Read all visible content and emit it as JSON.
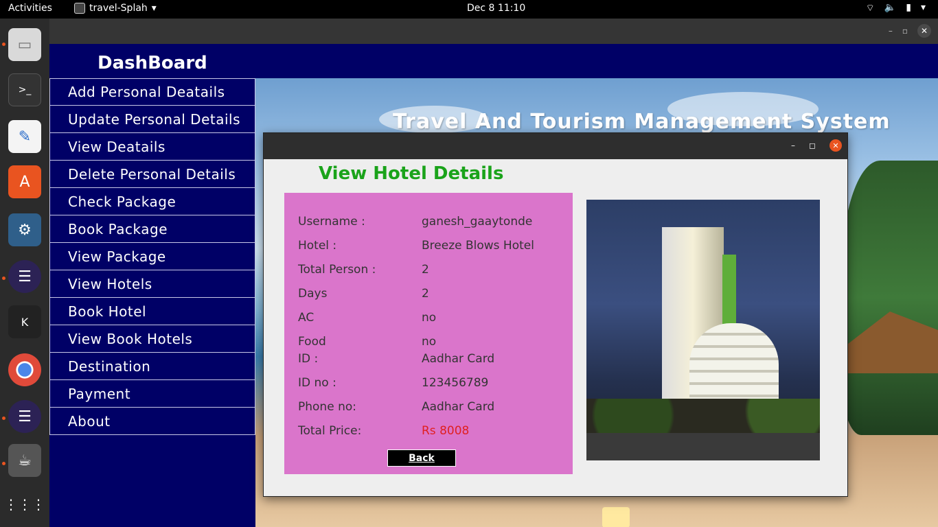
{
  "topbar": {
    "activities": "Activities",
    "app_name": "travel-Splah",
    "clock": "Dec 8  11:10"
  },
  "dock": {
    "items": [
      "files-icon",
      "terminal-icon",
      "text-editor-icon",
      "app-store-icon",
      "mysql-workbench-icon",
      "eclipse-icon",
      "kde-connect-icon",
      "chrome-icon",
      "eclipse-icon-2",
      "java-icon",
      "show-apps-icon"
    ]
  },
  "dashboard": {
    "title": "DashBoard",
    "system_name": "Travel And Tourism Management System",
    "menu": [
      "Add Personal Deatails",
      "Update Personal Details",
      "View Deatails",
      "Delete Personal Details",
      "Check Package",
      "Book Package",
      "View Package",
      "View Hotels",
      "Book Hotel",
      "View Book Hotels",
      "Destination",
      "Payment",
      "About"
    ]
  },
  "dialog": {
    "heading": "View Hotel Details",
    "rows": [
      {
        "label": "Username :",
        "value": "ganesh_gaaytonde"
      },
      {
        "label": "Hotel :",
        "value": "Breeze Blows Hotel"
      },
      {
        "label": "Total Person :",
        "value": "2"
      },
      {
        "label": "Days",
        "value": "2"
      },
      {
        "label": "AC",
        "value": "no"
      },
      {
        "label": "Food",
        "value": "no"
      },
      {
        "label": "ID :",
        "value": "Aadhar Card"
      },
      {
        "label": "ID no :",
        "value": "123456789"
      },
      {
        "label": "Phone no:",
        "value": "Aadhar Card"
      },
      {
        "label": "Total Price:",
        "value": "Rs 8008"
      }
    ],
    "back_label": "Back",
    "colors": {
      "heading": "#1aa31a",
      "panel": "#da75cb",
      "price": "#e02020"
    }
  }
}
